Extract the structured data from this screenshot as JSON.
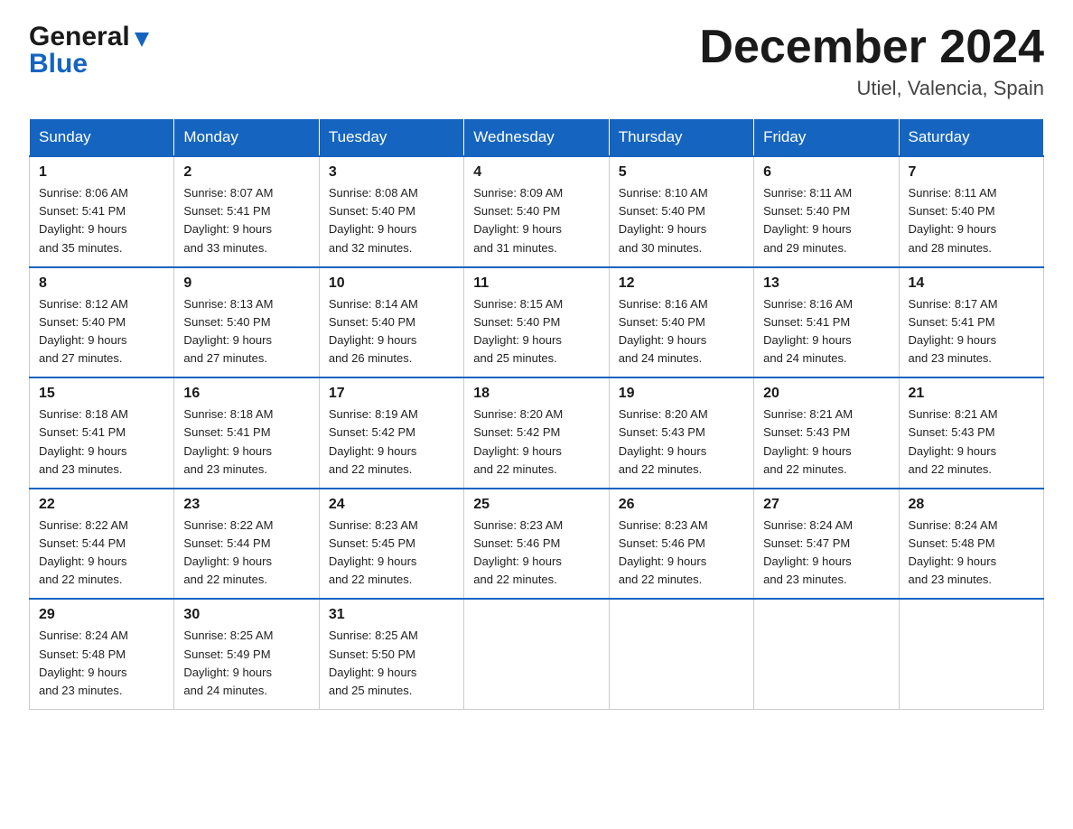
{
  "header": {
    "logo_general": "General",
    "logo_blue": "Blue",
    "month_title": "December 2024",
    "subtitle": "Utiel, Valencia, Spain"
  },
  "days_of_week": [
    "Sunday",
    "Monday",
    "Tuesday",
    "Wednesday",
    "Thursday",
    "Friday",
    "Saturday"
  ],
  "weeks": [
    [
      {
        "day": "1",
        "sunrise": "8:06 AM",
        "sunset": "5:41 PM",
        "daylight": "9 hours and 35 minutes."
      },
      {
        "day": "2",
        "sunrise": "8:07 AM",
        "sunset": "5:41 PM",
        "daylight": "9 hours and 33 minutes."
      },
      {
        "day": "3",
        "sunrise": "8:08 AM",
        "sunset": "5:40 PM",
        "daylight": "9 hours and 32 minutes."
      },
      {
        "day": "4",
        "sunrise": "8:09 AM",
        "sunset": "5:40 PM",
        "daylight": "9 hours and 31 minutes."
      },
      {
        "day": "5",
        "sunrise": "8:10 AM",
        "sunset": "5:40 PM",
        "daylight": "9 hours and 30 minutes."
      },
      {
        "day": "6",
        "sunrise": "8:11 AM",
        "sunset": "5:40 PM",
        "daylight": "9 hours and 29 minutes."
      },
      {
        "day": "7",
        "sunrise": "8:11 AM",
        "sunset": "5:40 PM",
        "daylight": "9 hours and 28 minutes."
      }
    ],
    [
      {
        "day": "8",
        "sunrise": "8:12 AM",
        "sunset": "5:40 PM",
        "daylight": "9 hours and 27 minutes."
      },
      {
        "day": "9",
        "sunrise": "8:13 AM",
        "sunset": "5:40 PM",
        "daylight": "9 hours and 27 minutes."
      },
      {
        "day": "10",
        "sunrise": "8:14 AM",
        "sunset": "5:40 PM",
        "daylight": "9 hours and 26 minutes."
      },
      {
        "day": "11",
        "sunrise": "8:15 AM",
        "sunset": "5:40 PM",
        "daylight": "9 hours and 25 minutes."
      },
      {
        "day": "12",
        "sunrise": "8:16 AM",
        "sunset": "5:40 PM",
        "daylight": "9 hours and 24 minutes."
      },
      {
        "day": "13",
        "sunrise": "8:16 AM",
        "sunset": "5:41 PM",
        "daylight": "9 hours and 24 minutes."
      },
      {
        "day": "14",
        "sunrise": "8:17 AM",
        "sunset": "5:41 PM",
        "daylight": "9 hours and 23 minutes."
      }
    ],
    [
      {
        "day": "15",
        "sunrise": "8:18 AM",
        "sunset": "5:41 PM",
        "daylight": "9 hours and 23 minutes."
      },
      {
        "day": "16",
        "sunrise": "8:18 AM",
        "sunset": "5:41 PM",
        "daylight": "9 hours and 23 minutes."
      },
      {
        "day": "17",
        "sunrise": "8:19 AM",
        "sunset": "5:42 PM",
        "daylight": "9 hours and 22 minutes."
      },
      {
        "day": "18",
        "sunrise": "8:20 AM",
        "sunset": "5:42 PM",
        "daylight": "9 hours and 22 minutes."
      },
      {
        "day": "19",
        "sunrise": "8:20 AM",
        "sunset": "5:43 PM",
        "daylight": "9 hours and 22 minutes."
      },
      {
        "day": "20",
        "sunrise": "8:21 AM",
        "sunset": "5:43 PM",
        "daylight": "9 hours and 22 minutes."
      },
      {
        "day": "21",
        "sunrise": "8:21 AM",
        "sunset": "5:43 PM",
        "daylight": "9 hours and 22 minutes."
      }
    ],
    [
      {
        "day": "22",
        "sunrise": "8:22 AM",
        "sunset": "5:44 PM",
        "daylight": "9 hours and 22 minutes."
      },
      {
        "day": "23",
        "sunrise": "8:22 AM",
        "sunset": "5:44 PM",
        "daylight": "9 hours and 22 minutes."
      },
      {
        "day": "24",
        "sunrise": "8:23 AM",
        "sunset": "5:45 PM",
        "daylight": "9 hours and 22 minutes."
      },
      {
        "day": "25",
        "sunrise": "8:23 AM",
        "sunset": "5:46 PM",
        "daylight": "9 hours and 22 minutes."
      },
      {
        "day": "26",
        "sunrise": "8:23 AM",
        "sunset": "5:46 PM",
        "daylight": "9 hours and 22 minutes."
      },
      {
        "day": "27",
        "sunrise": "8:24 AM",
        "sunset": "5:47 PM",
        "daylight": "9 hours and 23 minutes."
      },
      {
        "day": "28",
        "sunrise": "8:24 AM",
        "sunset": "5:48 PM",
        "daylight": "9 hours and 23 minutes."
      }
    ],
    [
      {
        "day": "29",
        "sunrise": "8:24 AM",
        "sunset": "5:48 PM",
        "daylight": "9 hours and 23 minutes."
      },
      {
        "day": "30",
        "sunrise": "8:25 AM",
        "sunset": "5:49 PM",
        "daylight": "9 hours and 24 minutes."
      },
      {
        "day": "31",
        "sunrise": "8:25 AM",
        "sunset": "5:50 PM",
        "daylight": "9 hours and 25 minutes."
      },
      null,
      null,
      null,
      null
    ]
  ]
}
